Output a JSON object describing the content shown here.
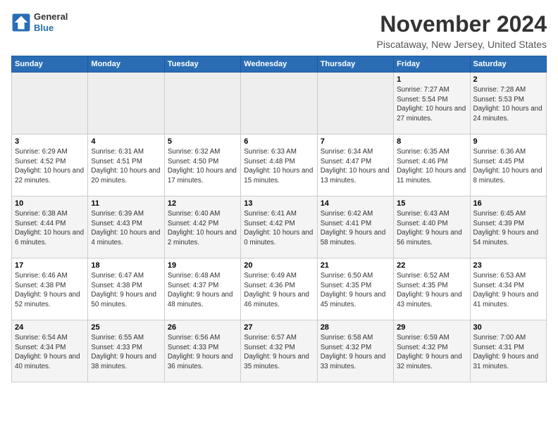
{
  "header": {
    "logo_line1": "General",
    "logo_line2": "Blue",
    "month": "November 2024",
    "location": "Piscataway, New Jersey, United States"
  },
  "weekdays": [
    "Sunday",
    "Monday",
    "Tuesday",
    "Wednesday",
    "Thursday",
    "Friday",
    "Saturday"
  ],
  "weeks": [
    [
      {
        "day": "",
        "info": ""
      },
      {
        "day": "",
        "info": ""
      },
      {
        "day": "",
        "info": ""
      },
      {
        "day": "",
        "info": ""
      },
      {
        "day": "",
        "info": ""
      },
      {
        "day": "1",
        "info": "Sunrise: 7:27 AM\nSunset: 5:54 PM\nDaylight: 10 hours and 27 minutes."
      },
      {
        "day": "2",
        "info": "Sunrise: 7:28 AM\nSunset: 5:53 PM\nDaylight: 10 hours and 24 minutes."
      }
    ],
    [
      {
        "day": "3",
        "info": "Sunrise: 6:29 AM\nSunset: 4:52 PM\nDaylight: 10 hours and 22 minutes."
      },
      {
        "day": "4",
        "info": "Sunrise: 6:31 AM\nSunset: 4:51 PM\nDaylight: 10 hours and 20 minutes."
      },
      {
        "day": "5",
        "info": "Sunrise: 6:32 AM\nSunset: 4:50 PM\nDaylight: 10 hours and 17 minutes."
      },
      {
        "day": "6",
        "info": "Sunrise: 6:33 AM\nSunset: 4:48 PM\nDaylight: 10 hours and 15 minutes."
      },
      {
        "day": "7",
        "info": "Sunrise: 6:34 AM\nSunset: 4:47 PM\nDaylight: 10 hours and 13 minutes."
      },
      {
        "day": "8",
        "info": "Sunrise: 6:35 AM\nSunset: 4:46 PM\nDaylight: 10 hours and 11 minutes."
      },
      {
        "day": "9",
        "info": "Sunrise: 6:36 AM\nSunset: 4:45 PM\nDaylight: 10 hours and 8 minutes."
      }
    ],
    [
      {
        "day": "10",
        "info": "Sunrise: 6:38 AM\nSunset: 4:44 PM\nDaylight: 10 hours and 6 minutes."
      },
      {
        "day": "11",
        "info": "Sunrise: 6:39 AM\nSunset: 4:43 PM\nDaylight: 10 hours and 4 minutes."
      },
      {
        "day": "12",
        "info": "Sunrise: 6:40 AM\nSunset: 4:42 PM\nDaylight: 10 hours and 2 minutes."
      },
      {
        "day": "13",
        "info": "Sunrise: 6:41 AM\nSunset: 4:42 PM\nDaylight: 10 hours and 0 minutes."
      },
      {
        "day": "14",
        "info": "Sunrise: 6:42 AM\nSunset: 4:41 PM\nDaylight: 9 hours and 58 minutes."
      },
      {
        "day": "15",
        "info": "Sunrise: 6:43 AM\nSunset: 4:40 PM\nDaylight: 9 hours and 56 minutes."
      },
      {
        "day": "16",
        "info": "Sunrise: 6:45 AM\nSunset: 4:39 PM\nDaylight: 9 hours and 54 minutes."
      }
    ],
    [
      {
        "day": "17",
        "info": "Sunrise: 6:46 AM\nSunset: 4:38 PM\nDaylight: 9 hours and 52 minutes."
      },
      {
        "day": "18",
        "info": "Sunrise: 6:47 AM\nSunset: 4:38 PM\nDaylight: 9 hours and 50 minutes."
      },
      {
        "day": "19",
        "info": "Sunrise: 6:48 AM\nSunset: 4:37 PM\nDaylight: 9 hours and 48 minutes."
      },
      {
        "day": "20",
        "info": "Sunrise: 6:49 AM\nSunset: 4:36 PM\nDaylight: 9 hours and 46 minutes."
      },
      {
        "day": "21",
        "info": "Sunrise: 6:50 AM\nSunset: 4:35 PM\nDaylight: 9 hours and 45 minutes."
      },
      {
        "day": "22",
        "info": "Sunrise: 6:52 AM\nSunset: 4:35 PM\nDaylight: 9 hours and 43 minutes."
      },
      {
        "day": "23",
        "info": "Sunrise: 6:53 AM\nSunset: 4:34 PM\nDaylight: 9 hours and 41 minutes."
      }
    ],
    [
      {
        "day": "24",
        "info": "Sunrise: 6:54 AM\nSunset: 4:34 PM\nDaylight: 9 hours and 40 minutes."
      },
      {
        "day": "25",
        "info": "Sunrise: 6:55 AM\nSunset: 4:33 PM\nDaylight: 9 hours and 38 minutes."
      },
      {
        "day": "26",
        "info": "Sunrise: 6:56 AM\nSunset: 4:33 PM\nDaylight: 9 hours and 36 minutes."
      },
      {
        "day": "27",
        "info": "Sunrise: 6:57 AM\nSunset: 4:32 PM\nDaylight: 9 hours and 35 minutes."
      },
      {
        "day": "28",
        "info": "Sunrise: 6:58 AM\nSunset: 4:32 PM\nDaylight: 9 hours and 33 minutes."
      },
      {
        "day": "29",
        "info": "Sunrise: 6:59 AM\nSunset: 4:32 PM\nDaylight: 9 hours and 32 minutes."
      },
      {
        "day": "30",
        "info": "Sunrise: 7:00 AM\nSunset: 4:31 PM\nDaylight: 9 hours and 31 minutes."
      }
    ]
  ]
}
